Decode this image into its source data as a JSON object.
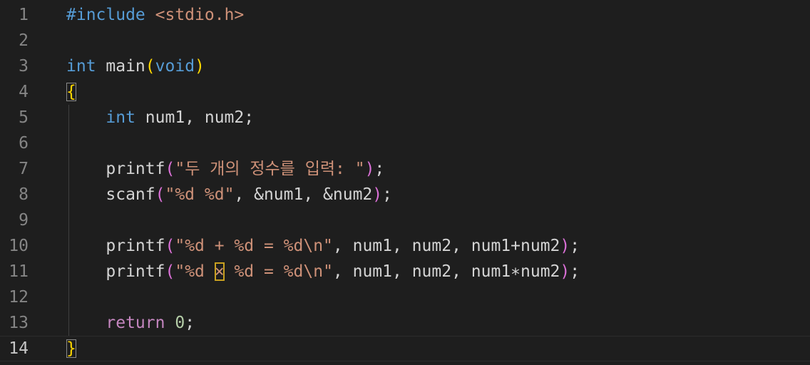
{
  "editor": {
    "active_line": 14,
    "theme_colors": {
      "background": "#1e1e1e",
      "keyword": "#569cd6",
      "string": "#ce9178",
      "number": "#b5cea8",
      "bracket_level1": "#ffd700",
      "bracket_level2": "#da70d6",
      "control": "#c586c0",
      "line_number": "#858585"
    },
    "lines": [
      {
        "number": "1",
        "tokens": [
          {
            "t": "#include",
            "c": "pp"
          },
          {
            "t": " ",
            "c": "plain"
          },
          {
            "t": "<stdio.h>",
            "c": "inc"
          }
        ]
      },
      {
        "number": "2",
        "tokens": []
      },
      {
        "number": "3",
        "tokens": [
          {
            "t": "int",
            "c": "kw"
          },
          {
            "t": " main",
            "c": "fn"
          },
          {
            "t": "(",
            "c": "b1"
          },
          {
            "t": "void",
            "c": "kw"
          },
          {
            "t": ")",
            "c": "b1"
          }
        ]
      },
      {
        "number": "4",
        "tokens": [
          {
            "t": "{",
            "c": "b1",
            "box": "bracket"
          }
        ]
      },
      {
        "number": "5",
        "tokens": [
          {
            "t": "    ",
            "c": "plain"
          },
          {
            "t": "int",
            "c": "kw"
          },
          {
            "t": " num1, num2;",
            "c": "plain"
          }
        ]
      },
      {
        "number": "6",
        "tokens": []
      },
      {
        "number": "7",
        "tokens": [
          {
            "t": "    printf",
            "c": "fn"
          },
          {
            "t": "(",
            "c": "b2"
          },
          {
            "t": "\"두 개의 정수를 입력: \"",
            "c": "str"
          },
          {
            "t": ")",
            "c": "b2"
          },
          {
            "t": ";",
            "c": "plain"
          }
        ]
      },
      {
        "number": "8",
        "tokens": [
          {
            "t": "    scanf",
            "c": "fn"
          },
          {
            "t": "(",
            "c": "b2"
          },
          {
            "t": "\"%d %d\"",
            "c": "str"
          },
          {
            "t": ", &num1, &num2",
            "c": "plain"
          },
          {
            "t": ")",
            "c": "b2"
          },
          {
            "t": ";",
            "c": "plain"
          }
        ]
      },
      {
        "number": "9",
        "tokens": []
      },
      {
        "number": "10",
        "tokens": [
          {
            "t": "    printf",
            "c": "fn"
          },
          {
            "t": "(",
            "c": "b2"
          },
          {
            "t": "\"%d + %d = %d\\n\"",
            "c": "str"
          },
          {
            "t": ", num1, num2, num1+num2",
            "c": "plain"
          },
          {
            "t": ")",
            "c": "b2"
          },
          {
            "t": ";",
            "c": "plain"
          }
        ]
      },
      {
        "number": "11",
        "tokens": [
          {
            "t": "    printf",
            "c": "fn"
          },
          {
            "t": "(",
            "c": "b2"
          },
          {
            "t": "\"%d ",
            "c": "str"
          },
          {
            "t": "×",
            "c": "str",
            "box": "char"
          },
          {
            "t": " %d = %d\\n\"",
            "c": "str"
          },
          {
            "t": ", num1, num2, num1∗num2",
            "c": "plain"
          },
          {
            "t": ")",
            "c": "b2"
          },
          {
            "t": ";",
            "c": "plain"
          }
        ]
      },
      {
        "number": "12",
        "tokens": []
      },
      {
        "number": "13",
        "tokens": [
          {
            "t": "    ",
            "c": "plain"
          },
          {
            "t": "return",
            "c": "ctrl"
          },
          {
            "t": " ",
            "c": "plain"
          },
          {
            "t": "0",
            "c": "num"
          },
          {
            "t": ";",
            "c": "plain"
          }
        ]
      },
      {
        "number": "14",
        "tokens": [
          {
            "t": "}",
            "c": "b1",
            "box": "bracket"
          }
        ]
      }
    ]
  }
}
